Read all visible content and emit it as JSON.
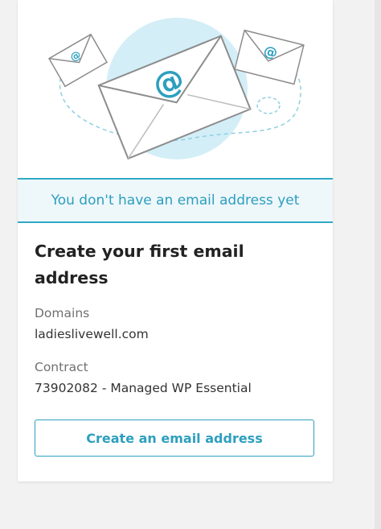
{
  "banner": {
    "text": "You don't have an email address yet"
  },
  "heading": {
    "title": "Create your first email address"
  },
  "details": {
    "domains_label": "Domains",
    "domains_value": "ladieslivewell.com",
    "contract_label": "Contract",
    "contract_value": "73902082 - Managed WP Essential"
  },
  "actions": {
    "create_label": "Create an email address"
  },
  "illustration": {
    "at_symbol": "@",
    "icons": [
      "envelope-icon",
      "envelope-icon",
      "envelope-icon"
    ]
  },
  "colors": {
    "accent": "#2d9fbe",
    "banner_bg": "#eef7fa",
    "circle": "#d3eef7"
  }
}
